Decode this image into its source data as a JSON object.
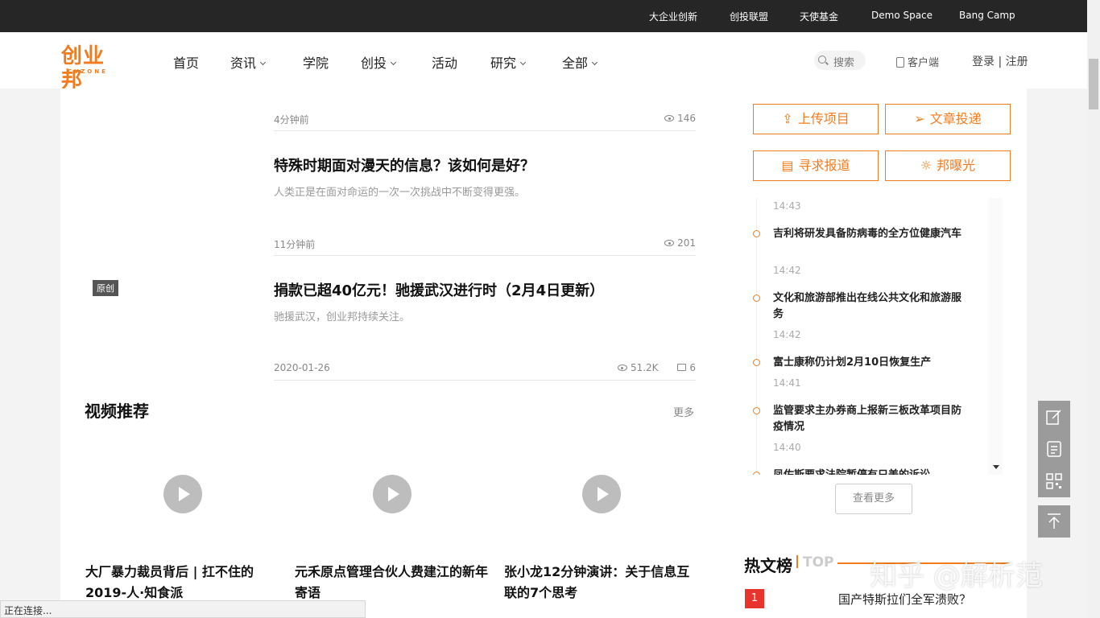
{
  "topbar": {
    "links": [
      "大企业创新",
      "创投联盟",
      "天使基金",
      "Demo Space",
      "Bang Camp"
    ]
  },
  "nav": {
    "logo": {
      "cn": "创业邦",
      "en": "CYZONE"
    },
    "items": [
      "首页",
      "资讯",
      "学院",
      "创投",
      "活动",
      "研究",
      "全部"
    ],
    "search_label": "搜索",
    "client_label": "客户端",
    "login_label": "登录 | 注册"
  },
  "articles": {
    "first_meta": {
      "time": "4分钟前",
      "views": "146"
    },
    "items": [
      {
        "title": "特殊时期面对漫天的信息？该如何是好？",
        "desc": "人类正是在面对命运的一次一次挑战中不断变得更强。",
        "time": "11分钟前",
        "views": "201"
      },
      {
        "badge": "原创",
        "title": "捐款已超40亿元！驰援武汉进行时（2月4日更新）",
        "desc": "驰援武汉，创业邦持续关注。",
        "time": "2020-01-26",
        "views": "51.2K",
        "comments": "6"
      }
    ]
  },
  "videos": {
    "title": "视频推荐",
    "more": "更多",
    "items": [
      {
        "title": "大厂暴力裁员背后 | 扛不住的2019-人·知食派"
      },
      {
        "title": "元禾原点管理合伙人费建江的新年寄语"
      },
      {
        "title": "张小龙12分钟演讲：关于信息互联的7个思考"
      }
    ]
  },
  "sidebar": {
    "buttons": [
      "上传项目",
      "文章投递",
      "寻求报道",
      "邦曝光"
    ],
    "feed_top_time": "14:43",
    "feed": [
      {
        "text": "吉利将研发具备防病毒的全方位健康汽车",
        "time": "14:42"
      },
      {
        "text": "文化和旅游部推出在线公共文化和旅游服务",
        "time": "14:42"
      },
      {
        "text": "富士康称仍计划2月10日恢复生产",
        "time": "14:41"
      },
      {
        "text": "监管要求主办券商上报新三板改革项目防疫情况",
        "time": "14:40"
      },
      {
        "text": "凤佐斯要求法院暂停有只美的诉讼",
        "time": ""
      }
    ],
    "more_button": "查看更多"
  },
  "hot": {
    "title": "热文榜",
    "top_label": "TOP",
    "items": [
      {
        "rank": "1",
        "title": "国产特斯拉们全军溃败？"
      }
    ],
    "watermark": "知乎 @解析范"
  },
  "status_bar": "正在连接...",
  "colors": {
    "accent": "#f07c1f",
    "topbar": "#262626",
    "rank": "#e8342c"
  }
}
